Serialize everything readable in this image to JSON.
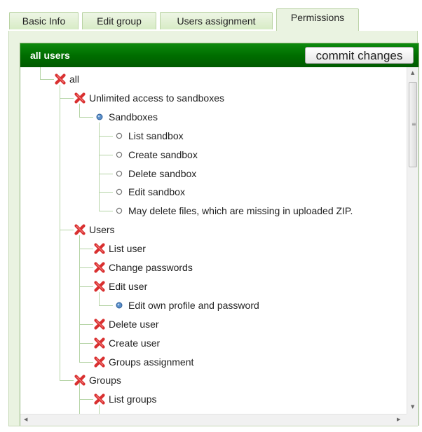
{
  "tabs": [
    {
      "label": "Basic Info",
      "active": false
    },
    {
      "label": "Edit group",
      "active": false
    },
    {
      "label": "Users assignment",
      "active": false
    },
    {
      "label": "Permissions",
      "active": true
    }
  ],
  "panel": {
    "title": "all users",
    "commit_label": "commit changes"
  },
  "colors": {
    "header_green": "#006e00",
    "tab_bg": "#d7ebc5",
    "panel_bg": "#eaf3e1",
    "deny_red": "#d93030",
    "partial_blue": "#5b8fc9",
    "tree_line": "#b5d4a6"
  },
  "tree": [
    {
      "label": "all",
      "state": "denied",
      "icon": "red-x-icon"
    },
    {
      "label": "Unlimited access to sandboxes",
      "state": "denied",
      "icon": "red-x-icon"
    },
    {
      "label": "Sandboxes",
      "state": "partial",
      "icon": "blue-dot-icon"
    },
    {
      "label": "List sandbox",
      "state": "none",
      "icon": "hollow-circle-icon"
    },
    {
      "label": "Create sandbox",
      "state": "none",
      "icon": "hollow-circle-icon"
    },
    {
      "label": "Delete sandbox",
      "state": "none",
      "icon": "hollow-circle-icon"
    },
    {
      "label": "Edit sandbox",
      "state": "none",
      "icon": "hollow-circle-icon"
    },
    {
      "label": "May delete files, which are missing in uploaded ZIP.",
      "state": "none",
      "icon": "hollow-circle-icon"
    },
    {
      "label": "Users",
      "state": "denied",
      "icon": "red-x-icon"
    },
    {
      "label": "List user",
      "state": "denied",
      "icon": "red-x-icon"
    },
    {
      "label": "Change passwords",
      "state": "denied",
      "icon": "red-x-icon"
    },
    {
      "label": "Edit user",
      "state": "denied",
      "icon": "red-x-icon"
    },
    {
      "label": "Edit own profile and password",
      "state": "partial",
      "icon": "blue-dot-icon"
    },
    {
      "label": "Delete user",
      "state": "denied",
      "icon": "red-x-icon"
    },
    {
      "label": "Create user",
      "state": "denied",
      "icon": "red-x-icon"
    },
    {
      "label": "Groups assignment",
      "state": "denied",
      "icon": "red-x-icon"
    },
    {
      "label": "Groups",
      "state": "denied",
      "icon": "red-x-icon"
    },
    {
      "label": "List groups",
      "state": "denied",
      "icon": "red-x-icon"
    }
  ]
}
